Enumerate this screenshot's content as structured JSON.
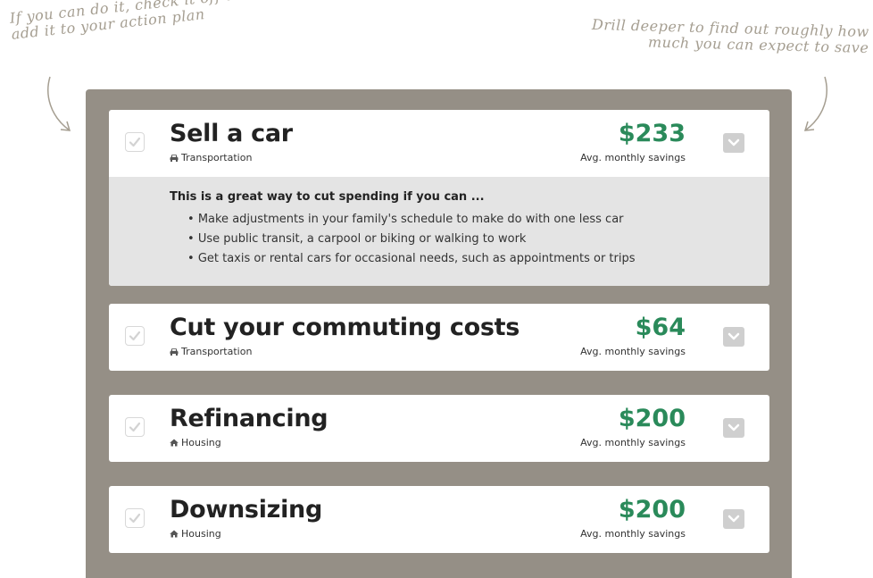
{
  "notes": {
    "left": "If you can do it, check it off and we'll add it to your action plan",
    "right": "Drill deeper to find out roughly how much you can expect to save"
  },
  "colors": {
    "panel": "#958f86",
    "amount": "#2a8a5a",
    "detail_bg": "#e4e4e4",
    "toggle_bg": "#cfcfcf",
    "note": "#a59e91"
  },
  "cards": [
    {
      "title": "Sell a car",
      "category": "Transportation",
      "category_icon": "car-icon",
      "amount": "$233",
      "amount_label": "Avg. monthly savings",
      "checked": false,
      "expanded": true,
      "detail": {
        "heading": "This is a great way to cut spending if you can ...",
        "items": [
          "Make adjustments in your family's schedule to make do with one less car",
          "Use public transit, a carpool or biking or walking to work",
          "Get taxis or rental cars for occasional needs, such as appointments or trips"
        ]
      }
    },
    {
      "title": "Cut your commuting costs",
      "category": "Transportation",
      "category_icon": "car-icon",
      "amount": "$64",
      "amount_label": "Avg. monthly savings",
      "checked": false,
      "expanded": false
    },
    {
      "title": "Refinancing",
      "category": "Housing",
      "category_icon": "house-icon",
      "amount": "$200",
      "amount_label": "Avg. monthly savings",
      "checked": false,
      "expanded": false
    },
    {
      "title": "Downsizing",
      "category": "Housing",
      "category_icon": "house-icon",
      "amount": "$200",
      "amount_label": "Avg. monthly savings",
      "checked": false,
      "expanded": false
    }
  ]
}
